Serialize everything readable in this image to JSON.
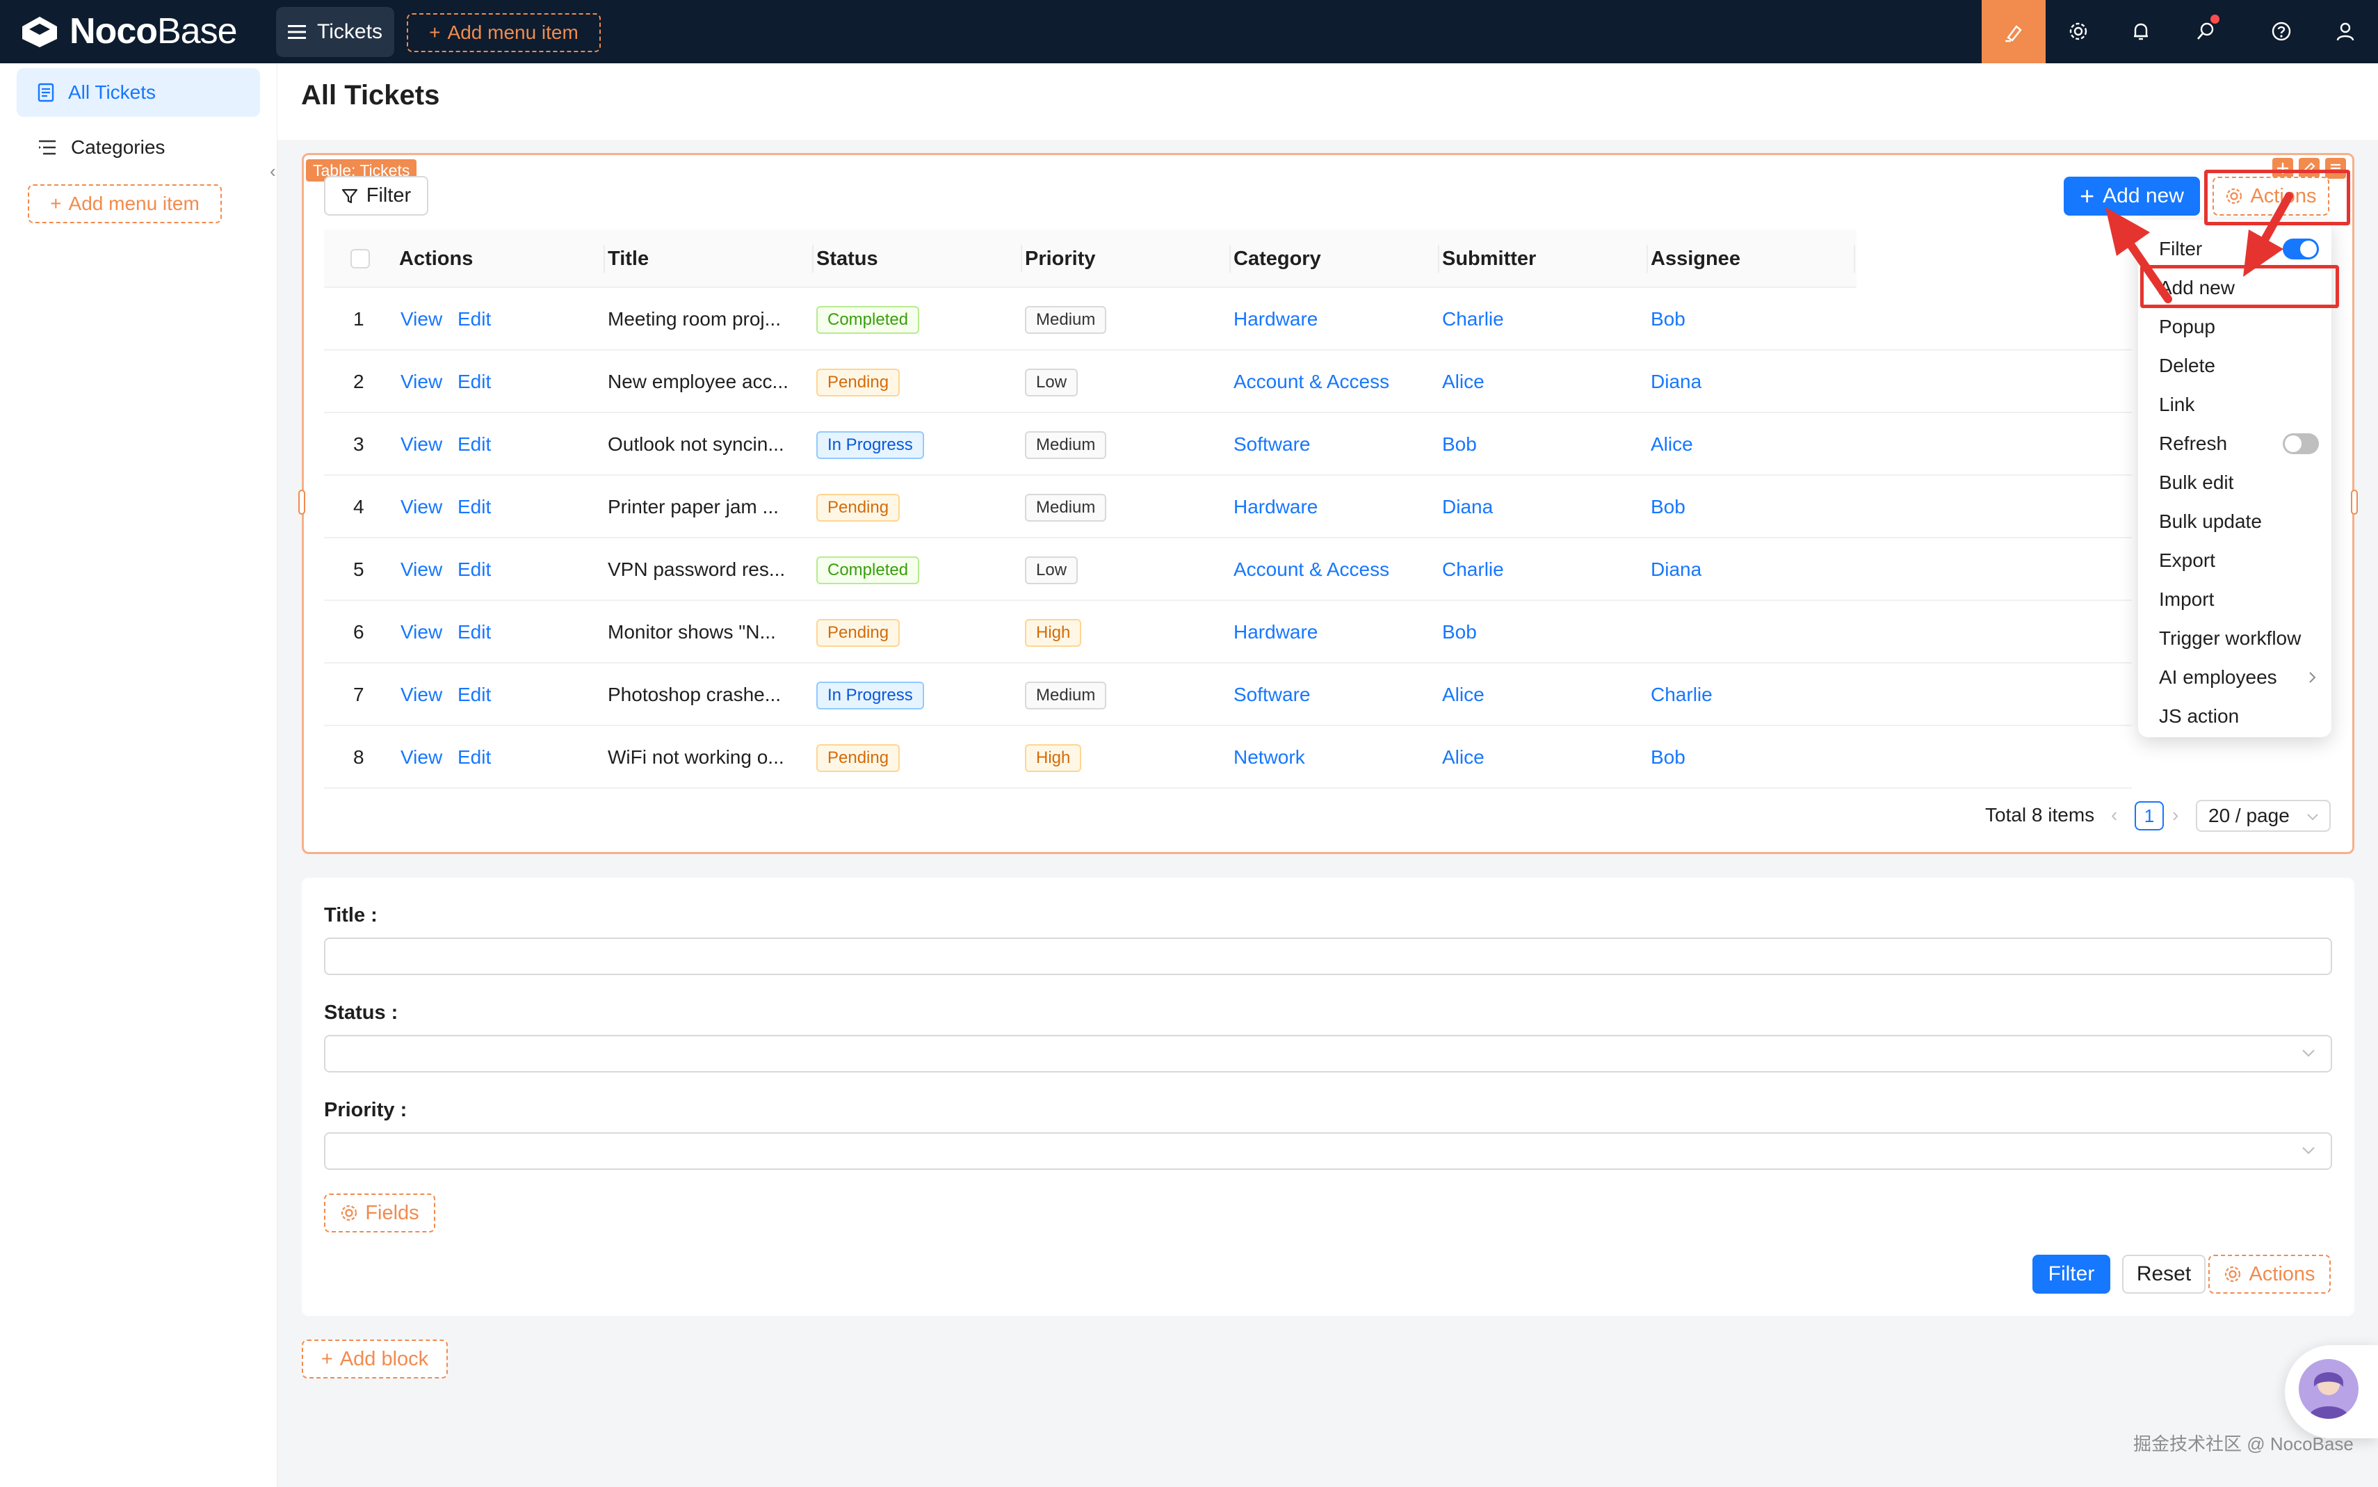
{
  "app": {
    "logo_bold": "Noco",
    "logo_light": "Base",
    "menu_tab_label": "Tickets",
    "add_menu_item_label": "Add menu item"
  },
  "sidebar": {
    "items": [
      {
        "label": "All Tickets",
        "icon": "document-icon",
        "active": true
      },
      {
        "label": "Categories",
        "icon": "list-icon",
        "active": false
      }
    ],
    "add_menu_item_label": "Add menu item"
  },
  "page": {
    "title": "All Tickets"
  },
  "table_block": {
    "tag_label": "Table: Tickets",
    "filter_label": "Filter",
    "add_new_label": "Add new",
    "actions_label": "Actions",
    "columns": [
      "Actions",
      "Title",
      "Status",
      "Priority",
      "Category",
      "Submitter",
      "Assignee"
    ],
    "row_actions": [
      "View",
      "Edit"
    ],
    "rows": [
      {
        "no": "1",
        "title": "Meeting room proj...",
        "status": "Completed",
        "priority": "Medium",
        "category": "Hardware",
        "submitter": "Charlie",
        "assignee": "Bob"
      },
      {
        "no": "2",
        "title": "New employee acc...",
        "status": "Pending",
        "priority": "Low",
        "category": "Account & Access",
        "submitter": "Alice",
        "assignee": "Diana"
      },
      {
        "no": "3",
        "title": "Outlook not syncin...",
        "status": "In Progress",
        "priority": "Medium",
        "category": "Software",
        "submitter": "Bob",
        "assignee": "Alice"
      },
      {
        "no": "4",
        "title": "Printer paper jam ...",
        "status": "Pending",
        "priority": "Medium",
        "category": "Hardware",
        "submitter": "Diana",
        "assignee": "Bob"
      },
      {
        "no": "5",
        "title": "VPN password res...",
        "status": "Completed",
        "priority": "Low",
        "category": "Account & Access",
        "submitter": "Charlie",
        "assignee": "Diana"
      },
      {
        "no": "6",
        "title": "Monitor shows \"N...",
        "status": "Pending",
        "priority": "High",
        "category": "Hardware",
        "submitter": "Bob",
        "assignee": ""
      },
      {
        "no": "7",
        "title": "Photoshop crashe...",
        "status": "In Progress",
        "priority": "Medium",
        "category": "Software",
        "submitter": "Alice",
        "assignee": "Charlie"
      },
      {
        "no": "8",
        "title": "WiFi not working o...",
        "status": "Pending",
        "priority": "High",
        "category": "Network",
        "submitter": "Alice",
        "assignee": "Bob"
      }
    ],
    "pagination": {
      "total_label": "Total 8 items",
      "current_page": "1",
      "page_size": "20 / page"
    }
  },
  "actions_menu": {
    "items": [
      {
        "label": "Filter",
        "toggle": "on"
      },
      {
        "label": "Add new",
        "toggle": "none",
        "highlighted": true
      },
      {
        "label": "Popup",
        "toggle": "none"
      },
      {
        "label": "Delete",
        "toggle": "none"
      },
      {
        "label": "Link",
        "toggle": "none"
      },
      {
        "label": "Refresh",
        "toggle": "off"
      },
      {
        "label": "Bulk edit",
        "toggle": "none"
      },
      {
        "label": "Bulk update",
        "toggle": "none"
      },
      {
        "label": "Export",
        "toggle": "none"
      },
      {
        "label": "Import",
        "toggle": "none"
      },
      {
        "label": "Trigger workflow",
        "toggle": "none"
      },
      {
        "label": "AI employees",
        "toggle": "submenu"
      },
      {
        "label": "JS action",
        "toggle": "none"
      }
    ]
  },
  "filter_form": {
    "fields": [
      {
        "label": "Title :",
        "type": "input",
        "value": ""
      },
      {
        "label": "Status :",
        "type": "select",
        "value": ""
      },
      {
        "label": "Priority :",
        "type": "select",
        "value": ""
      }
    ],
    "fields_button_label": "Fields",
    "submit_label": "Filter",
    "reset_label": "Reset",
    "actions_label": "Actions"
  },
  "add_block_label": "Add block",
  "watermark": "掘金技术社区 @ NocoBase",
  "colors": {
    "topbar": "#0d1c2e",
    "accent": "#1677ff",
    "editor_orange": "#f18b4e",
    "annotation_red": "#e5342f"
  }
}
